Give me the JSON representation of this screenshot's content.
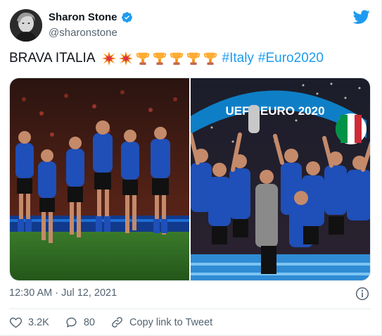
{
  "author": {
    "name": "Sharon Stone",
    "handle": "@sharonstone"
  },
  "icons": [
    "avatar",
    "verified-badge-icon",
    "twitter-bird-icon",
    "collision-emoji",
    "trophy-emoji",
    "info-icon",
    "heart-icon",
    "reply-icon",
    "link-icon"
  ],
  "tweet": {
    "text": "BRAVA ITALIA",
    "emojis": [
      "collision",
      "collision",
      "trophy",
      "trophy",
      "trophy",
      "trophy",
      "trophy"
    ],
    "hashtags": [
      "#Italy",
      "#Euro2020"
    ]
  },
  "media": {
    "banner_text": "UEFA EURO 2020",
    "left_photo": "players running onto pitch",
    "right_photo": "team celebrating with trophy"
  },
  "timestamp": "12:30 AM · Jul 12, 2021",
  "actions": {
    "likes": "3.2K",
    "replies": "80",
    "copy_link": "Copy link to Tweet"
  },
  "colors": {
    "accent": "#1d9bf0",
    "text": "#0f1419",
    "muted": "#536471",
    "italy_blue": "#1f4fb8"
  }
}
